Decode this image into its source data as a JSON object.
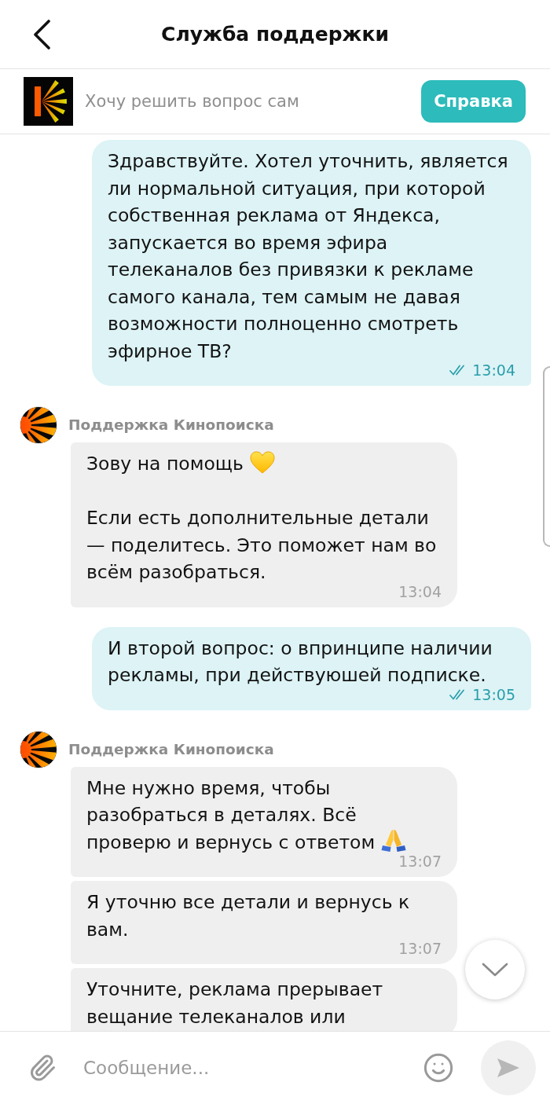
{
  "header": {
    "title": "Служба поддержки"
  },
  "banner": {
    "text": "Хочу решить вопрос сам",
    "button": "Справка"
  },
  "messages": [
    {
      "kind": "outgoing",
      "bubbles": [
        {
          "paragraphs": [
            {
              "kind": "plain",
              "text": "Здравствуйте. Хотел уточнить, является ли нормальной ситуация, при которой собственная реклама от Яндекса, запускается во время эфира телеканалов без привязки к рекламе самого канала, тем самым не давая возможности полноценно смотреть эфирное ТВ?"
            }
          ],
          "time": "13:04",
          "read": true
        }
      ]
    },
    {
      "kind": "incoming",
      "sender": "Поддержка Кинопоиска",
      "bubbles": [
        {
          "paragraphs": [
            {
              "kind": "heart",
              "text": "Зову на помощь"
            },
            {
              "kind": "plain",
              "text": "Если есть дополнительные детали — поделитесь. Это поможет нам во всём разобраться."
            }
          ],
          "time": "13:04"
        }
      ]
    },
    {
      "kind": "outgoing",
      "bubbles": [
        {
          "paragraphs": [
            {
              "kind": "plain",
              "text": "И второй вопрос: о впринципе наличии рекламы, при действуюшей подписке."
            }
          ],
          "time": "13:05",
          "read": true
        }
      ]
    },
    {
      "kind": "incoming",
      "sender": "Поддержка Кинопоиска",
      "bubbles": [
        {
          "paragraphs": [
            {
              "kind": "prayer",
              "text": "Мне нужно время, чтобы разобраться в деталях. Всё проверю и вернусь с ответом"
            }
          ],
          "time": "13:07"
        },
        {
          "paragraphs": [
            {
              "kind": "plain",
              "text": "Я уточню все детали и вернусь к вам."
            }
          ],
          "time": "13:07"
        },
        {
          "paragraphs": [
            {
              "kind": "plain",
              "text": "Уточните, реклама прерывает вещание телеканалов или"
            }
          ]
        }
      ]
    }
  ],
  "composer": {
    "placeholder": "Сообщение..."
  }
}
